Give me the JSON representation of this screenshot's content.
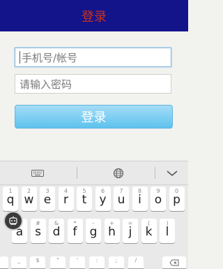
{
  "header": {
    "title": "登录"
  },
  "form": {
    "account_placeholder": "手机号/帐号",
    "password_placeholder": "请输入密码",
    "login_label": "登录"
  },
  "keyboard": {
    "row1": [
      {
        "ch": "q",
        "sym": "1"
      },
      {
        "ch": "w",
        "sym": "2"
      },
      {
        "ch": "e",
        "sym": "3"
      },
      {
        "ch": "r",
        "sym": "4"
      },
      {
        "ch": "t",
        "sym": "5"
      },
      {
        "ch": "y",
        "sym": "6"
      },
      {
        "ch": "u",
        "sym": "7"
      },
      {
        "ch": "i",
        "sym": "8"
      },
      {
        "ch": "o",
        "sym": "9"
      },
      {
        "ch": "p",
        "sym": "0"
      }
    ],
    "row2": [
      {
        "ch": "a",
        "sym": "@"
      },
      {
        "ch": "s",
        "sym": "#"
      },
      {
        "ch": "d",
        "sym": "&"
      },
      {
        "ch": "f",
        "sym": "*"
      },
      {
        "ch": "g",
        "sym": "-"
      },
      {
        "ch": "h",
        "sym": "+"
      },
      {
        "ch": "j",
        "sym": "="
      },
      {
        "ch": "k",
        "sym": "("
      },
      {
        "ch": "l",
        "sym": ")"
      }
    ],
    "row3_partial": [
      {
        "sym": "_"
      },
      {
        "sym": "$"
      },
      {
        "sym": "\""
      },
      {
        "sym": "'"
      },
      {
        "sym": ":"
      },
      {
        "sym": ";"
      },
      {
        "sym": "/"
      }
    ]
  }
}
